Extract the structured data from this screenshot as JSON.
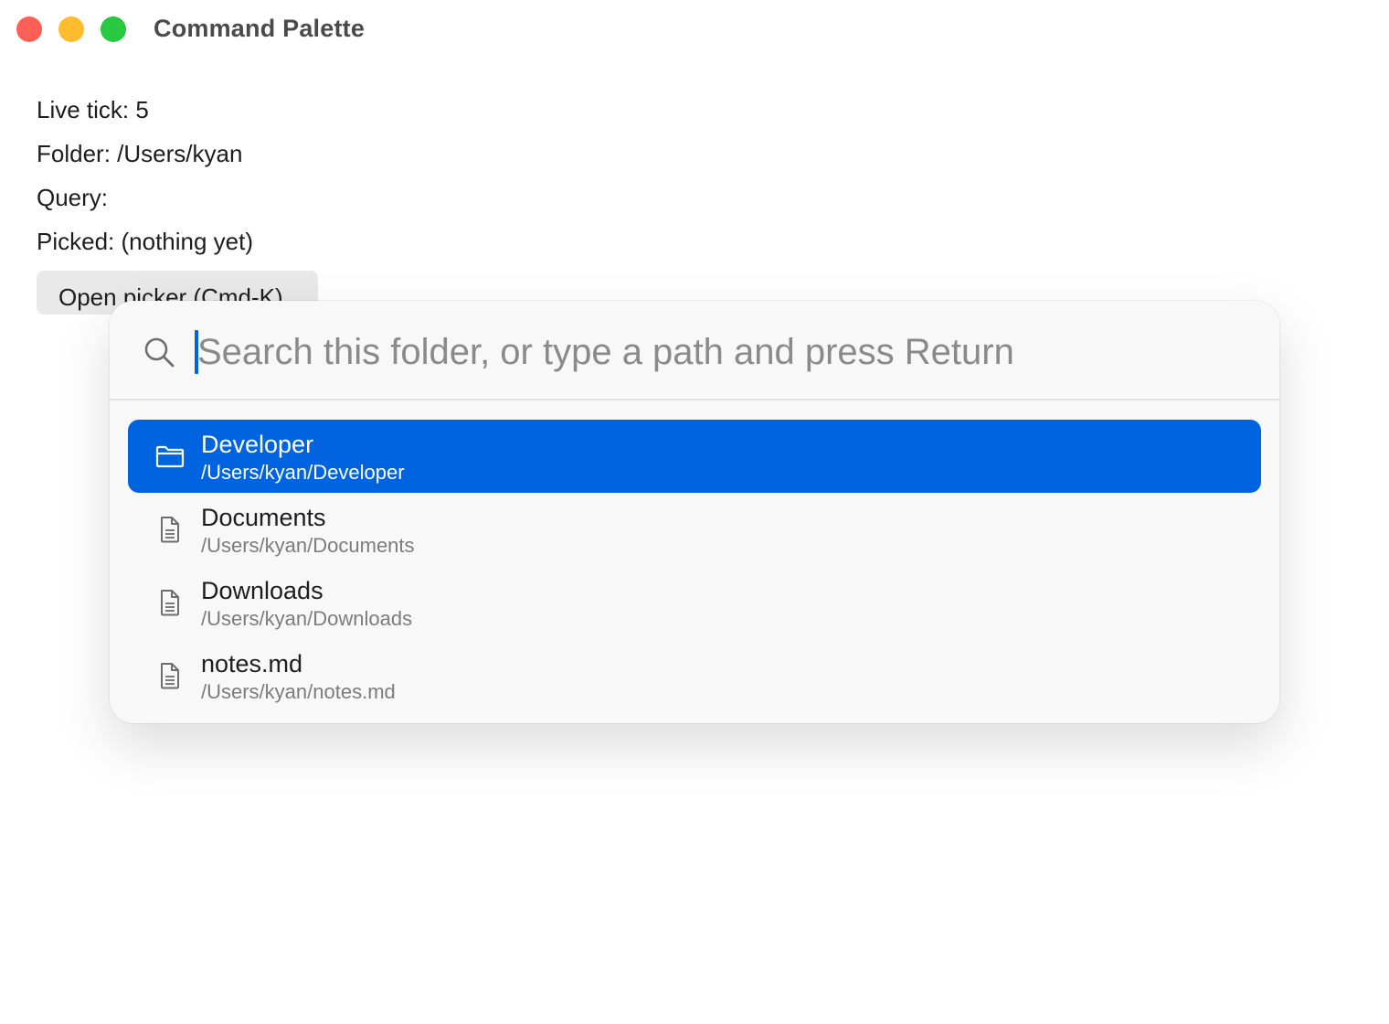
{
  "window": {
    "title": "Command Palette",
    "traffic_lights": {
      "close_color": "#ff5f57",
      "minimize_color": "#febc2e",
      "zoom_color": "#28c840"
    }
  },
  "status": {
    "live_tick": "Live tick: 5",
    "folder": "Folder: /Users/kyan",
    "query": "Query:",
    "picked": "Picked: (nothing yet)"
  },
  "open_picker_button": {
    "label": "Open picker (Cmd-K)"
  },
  "palette": {
    "search": {
      "placeholder": "Search this folder, or type a path and press Return",
      "value": "",
      "icon": "search-icon"
    },
    "selected_index": 0,
    "accent_color": "#0064e0",
    "results": [
      {
        "name": "Developer",
        "path": "/Users/kyan/Developer",
        "icon": "folder-icon"
      },
      {
        "name": "Documents",
        "path": "/Users/kyan/Documents",
        "icon": "document-icon"
      },
      {
        "name": "Downloads",
        "path": "/Users/kyan/Downloads",
        "icon": "document-icon"
      },
      {
        "name": "notes.md",
        "path": "/Users/kyan/notes.md",
        "icon": "document-icon"
      }
    ]
  }
}
